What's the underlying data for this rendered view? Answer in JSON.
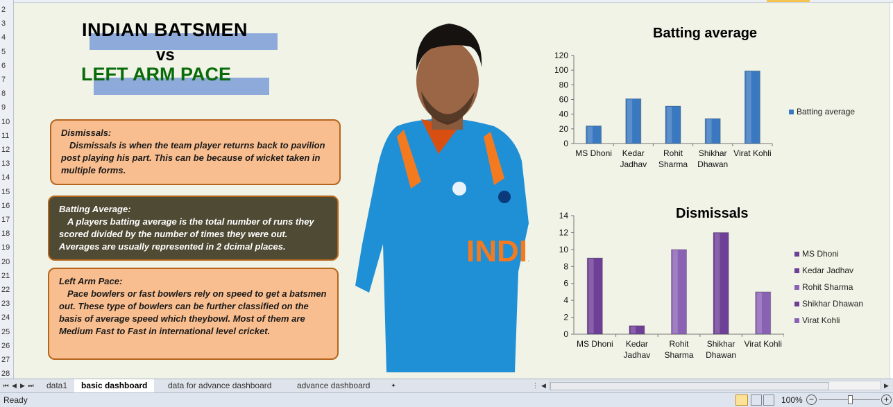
{
  "rows": [
    "2",
    "3",
    "4",
    "5",
    "6",
    "7",
    "8",
    "9",
    "10",
    "11",
    "12",
    "13",
    "14",
    "15",
    "16",
    "17",
    "18",
    "19",
    "20",
    "21",
    "22",
    "23",
    "24",
    "25",
    "26",
    "27",
    "28"
  ],
  "title": {
    "line1": "INDIAN BATSMEN",
    "vs": "vs",
    "line2": "LEFT ARM PACE"
  },
  "cards": [
    {
      "title": "Dismissals:",
      "body": "Dismissals is when the team player returns back to pavilion post playing his part. This can be because of wicket taken in multiple forms."
    },
    {
      "title": "Batting Average:",
      "body": "A players batting average is the total number of runs they scored divided by the number of times they were out. Averages are usually represented in 2 dcimal places."
    },
    {
      "title": "Left Arm Pace:",
      "body": "Pace bowlers or fast bowlers rely on speed to get a batsmen out. These type of bowlers can be further classified on the basis of average speed which theybowl. Most of them are Medium Fast to Fast in international level cricket."
    }
  ],
  "chart_data": [
    {
      "type": "bar",
      "title": "Batting average",
      "categories": [
        [
          "MS Dhoni"
        ],
        [
          "Kedar",
          "Jadhav"
        ],
        [
          "Rohit",
          "Sharma"
        ],
        [
          "Shikhar",
          "Dhawan"
        ],
        [
          "Virat Kohli"
        ]
      ],
      "series": [
        {
          "name": "Batting average",
          "values": [
            24,
            61,
            51,
            34,
            99
          ],
          "color": "#3a78c0"
        }
      ],
      "yticks": [
        "0",
        "20",
        "40",
        "60",
        "80",
        "100",
        "120"
      ],
      "ylim": [
        0,
        120
      ],
      "legend": "right"
    },
    {
      "type": "bar",
      "title": "Dismissals",
      "categories": [
        [
          "MS Dhoni"
        ],
        [
          "Kedar",
          "Jadhav"
        ],
        [
          "Rohit",
          "Sharma"
        ],
        [
          "Shikhar",
          "Dhawan"
        ],
        [
          "Virat Kohli"
        ]
      ],
      "values": [
        9,
        1,
        10,
        12,
        5
      ],
      "colors": [
        "#6e3f96",
        "#6e3f96",
        "#8a62b4",
        "#6e3f96",
        "#8a62b4"
      ],
      "legend_entries": [
        "MS Dhoni",
        "Kedar Jadhav",
        "Rohit Sharma",
        "Shikhar Dhawan",
        "Virat Kohli"
      ],
      "yticks": [
        "0",
        "2",
        "4",
        "6",
        "8",
        "10",
        "12",
        "14"
      ],
      "ylim": [
        0,
        14
      ],
      "legend": "right"
    }
  ],
  "tabs": {
    "items": [
      "data1",
      "basic dashboard",
      "data for advance dashboard",
      "advance dashboard"
    ],
    "active": "basic dashboard"
  },
  "status": {
    "ready": "Ready",
    "zoom": "100%"
  }
}
